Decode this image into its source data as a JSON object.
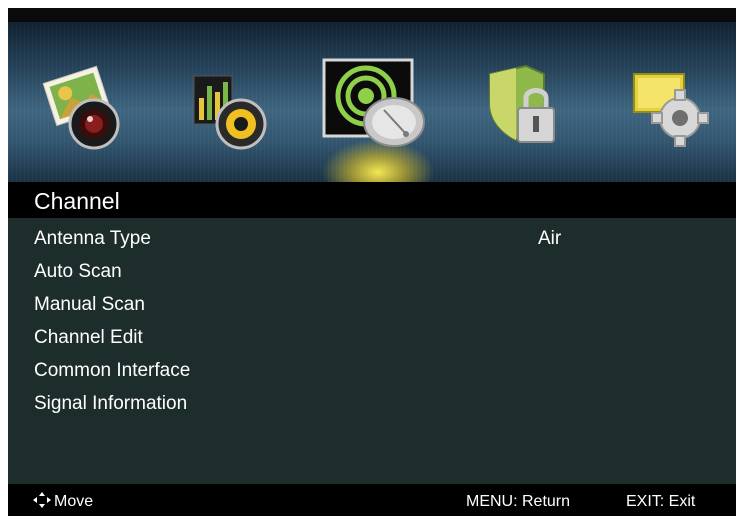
{
  "icons": [
    {
      "name": "picture-icon",
      "active": false
    },
    {
      "name": "sound-icon",
      "active": false
    },
    {
      "name": "channel-icon",
      "active": true
    },
    {
      "name": "lock-icon",
      "active": false
    },
    {
      "name": "setup-icon",
      "active": false
    }
  ],
  "menu": {
    "title": "Channel",
    "items": [
      {
        "label": "Antenna Type",
        "value": "Air"
      },
      {
        "label": "Auto Scan"
      },
      {
        "label": "Manual Scan"
      },
      {
        "label": "Channel Edit"
      },
      {
        "label": "Common Interface"
      },
      {
        "label": "Signal Information"
      }
    ]
  },
  "footer": {
    "move_label": "Move",
    "return_label": "MENU: Return",
    "exit_label": "EXIT: Exit"
  },
  "colors": {
    "menu_bg": "#1c2d2b",
    "bar_bg": "#000000",
    "icon_bar": "#3f6580",
    "highlight": "#f0e040"
  }
}
